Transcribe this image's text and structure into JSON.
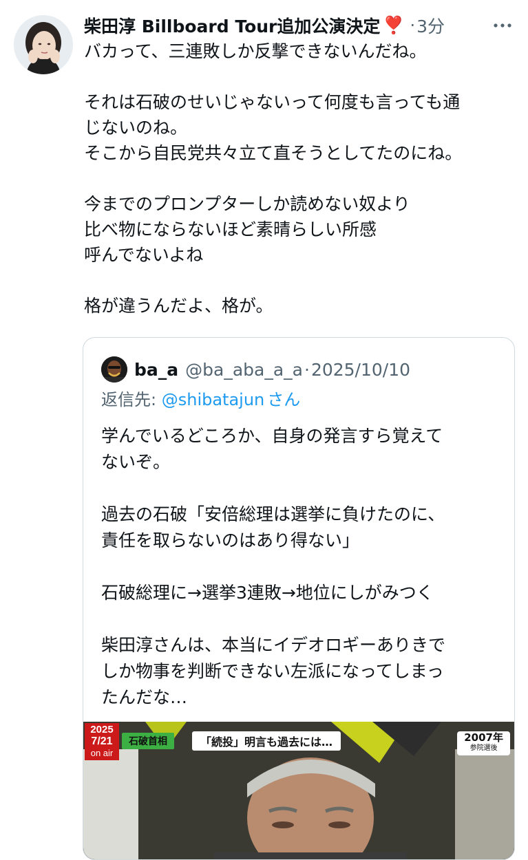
{
  "tweet": {
    "display_name": "柴田淳 Billboard Tour追加公演決定",
    "name_emoji": "❣️",
    "separator": "·",
    "time": "3分",
    "more_icon": "more-horizontal-icon",
    "body": [
      "バカって、三連敗しか反撃できないんだね。",
      "",
      "それは石破のせいじゃないって何度も言っても通",
      "じないのね。",
      "そこから自民党共々立て直そうとしてたのにね。",
      "",
      "今までのプロンプターしか読めない奴より",
      "比べ物にならないほど素晴らしい所感",
      "呼んでないよね",
      "",
      "格が違うんだよ、格が。"
    ]
  },
  "quote": {
    "name": "ba_a",
    "handle": "@ba_aba_a_a",
    "separator": "·",
    "date": "2025/10/10",
    "reply_label": "返信先:",
    "reply_to": "@shibatajun",
    "reply_suffix": "さん",
    "body": [
      "学んでいるどころか、自身の発言すら覚えて",
      "ないぞ。",
      "",
      "過去の石破「安倍総理は選挙に負けたのに、",
      "責任を取らないのはあり得ない」",
      "",
      "石破総理に→選挙3連敗→地位にしがみつく",
      "",
      "柴田淳さんは、本当にイデオロギーありきで",
      "しか物事を判断できない左派になってしまっ",
      "たんだな…"
    ],
    "media": {
      "date_year": "2025",
      "date_md": "7/21",
      "on_air": "on air",
      "caption_name": "石破首相",
      "caption_main": "「続投」明言も過去には…",
      "caption_year": "2007年",
      "caption_sub": "参院選後"
    }
  },
  "colors": {
    "text": "#0f1419",
    "secondary": "#536471",
    "link": "#1d9bf0",
    "border": "#cfd9de",
    "heart": "#e0245e"
  }
}
